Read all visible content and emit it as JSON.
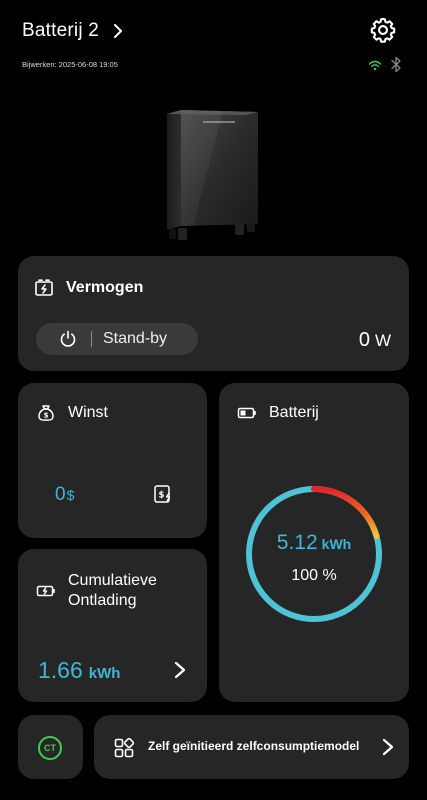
{
  "header": {
    "title": "Batterij 2",
    "updated": "Bijwerken: 2025-06-08 19:05"
  },
  "power": {
    "title": "Vermogen",
    "status": "Stand-by",
    "value": "0",
    "unit": "W"
  },
  "profit": {
    "title": "Winst",
    "value": "0",
    "unit": "$"
  },
  "battery": {
    "title": "Batterij",
    "energy": "5.12",
    "energy_unit": "kWh",
    "percent_label": "100 %",
    "percent": 100
  },
  "discharge": {
    "title_line1": "Cumulatieve",
    "title_line2": "Ontlading",
    "value": "1.66",
    "unit": "kWh"
  },
  "ct": {
    "label": "CT"
  },
  "mode": {
    "label": "Zelf geïnitieerd zelfconsumptiemodel"
  },
  "colors": {
    "accent": "#3fb6d8",
    "card": "#262626",
    "ct_green": "#3ccf4e",
    "wifi_green": "#3ccf4e"
  },
  "icons": [
    "chevron-right-icon",
    "gear-icon",
    "wifi-icon",
    "bluetooth-icon",
    "battery-charge-icon",
    "power-icon",
    "money-bag-icon",
    "money-flash-icon",
    "battery-icon",
    "battery-discharge-icon",
    "grid-apps-icon"
  ]
}
